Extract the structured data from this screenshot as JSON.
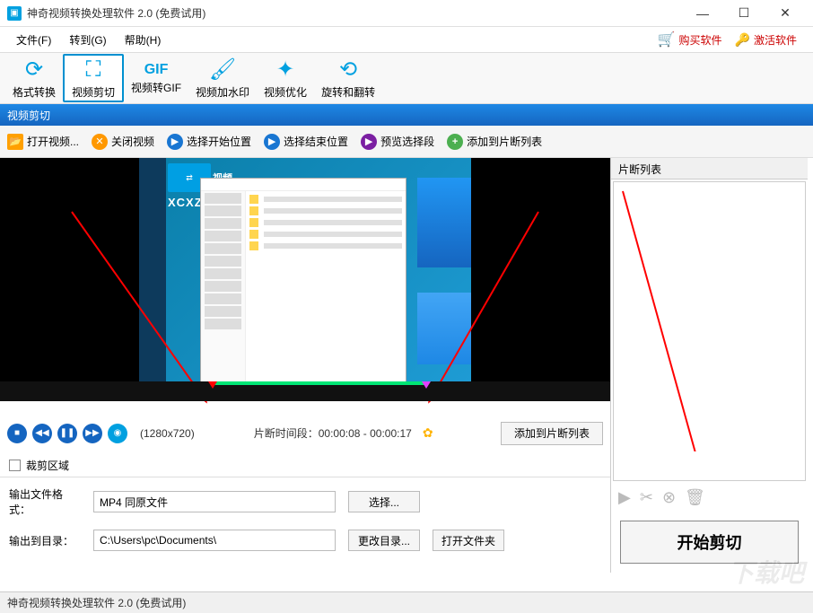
{
  "title": "神奇视频转换处理软件 2.0 (免费试用)",
  "menus": {
    "file": "文件(F)",
    "goto": "转到(G)",
    "help": "帮助(H)"
  },
  "right_links": {
    "buy": "购买软件",
    "activate": "激活软件"
  },
  "toolbar": {
    "format": "格式转换",
    "cut": "视频剪切",
    "gif": "视频转GIF",
    "watermark": "视频加水印",
    "optimize": "视频优化",
    "rotate": "旋转和翻转"
  },
  "section_title": "视频剪切",
  "actions": {
    "open": "打开视频...",
    "close": "关闭视频",
    "sel_start": "选择开始位置",
    "sel_end": "选择结束位置",
    "preview": "预览选择段",
    "add_frag": "添加到片断列表"
  },
  "mock": {
    "badge": "视频",
    "brand": "XCXZQ"
  },
  "controls": {
    "resolution": "(1280x720)",
    "time_label": "片断时间段：",
    "time_value": "00:00:08 - 00:00:17",
    "add_to_list": "添加到片断列表"
  },
  "crop_label": "裁剪区域",
  "output": {
    "format_label": "输出文件格式：",
    "format_value": "MP4 同原文件",
    "select_btn": "选择...",
    "dir_label": "输出到目录：",
    "dir_value": "C:\\Users\\pc\\Documents\\",
    "change_dir_btn": "更改目录...",
    "open_folder_btn": "打开文件夹"
  },
  "fragments": {
    "header": "片断列表"
  },
  "start_cut": "开始剪切",
  "status": "神奇视频转换处理软件 2.0 (免费试用)",
  "watermark": "下载吧"
}
